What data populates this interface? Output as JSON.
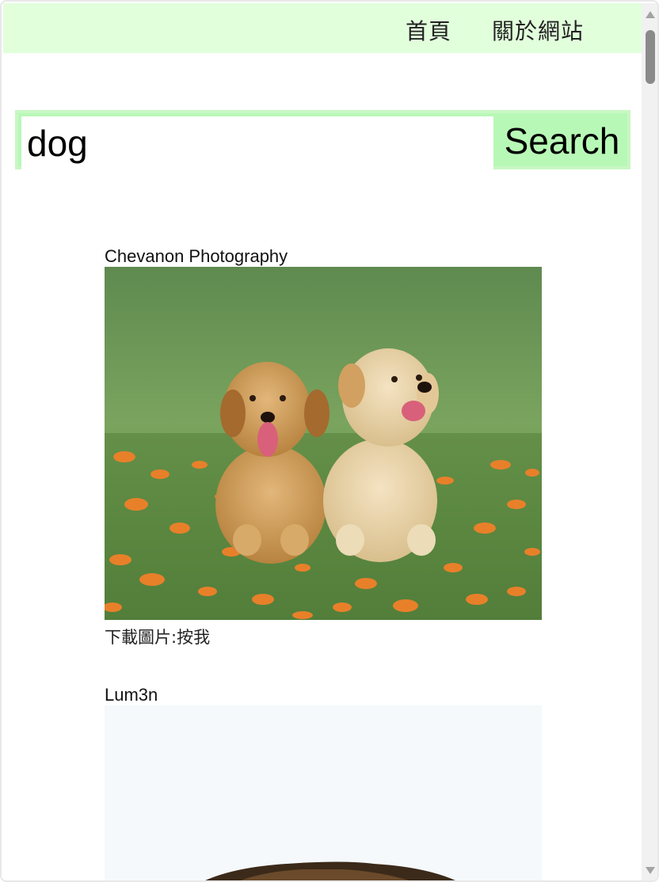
{
  "nav": {
    "home_label": "首頁",
    "about_label": "關於網站"
  },
  "search": {
    "value": "dog",
    "button_label": "Search"
  },
  "results": [
    {
      "photographer": "Chevanon Photography",
      "image": "two golden retriever puppies sitting in grass with orange flowers",
      "download_label": "下載圖片:按我"
    },
    {
      "photographer": "Lum3n",
      "image": "dog photo on pale background (partially visible)"
    }
  ],
  "colors": {
    "nav_bg": "#e2ffdc",
    "search_button_bg": "#b8f8b6",
    "search_border": "#c8f7c4"
  }
}
